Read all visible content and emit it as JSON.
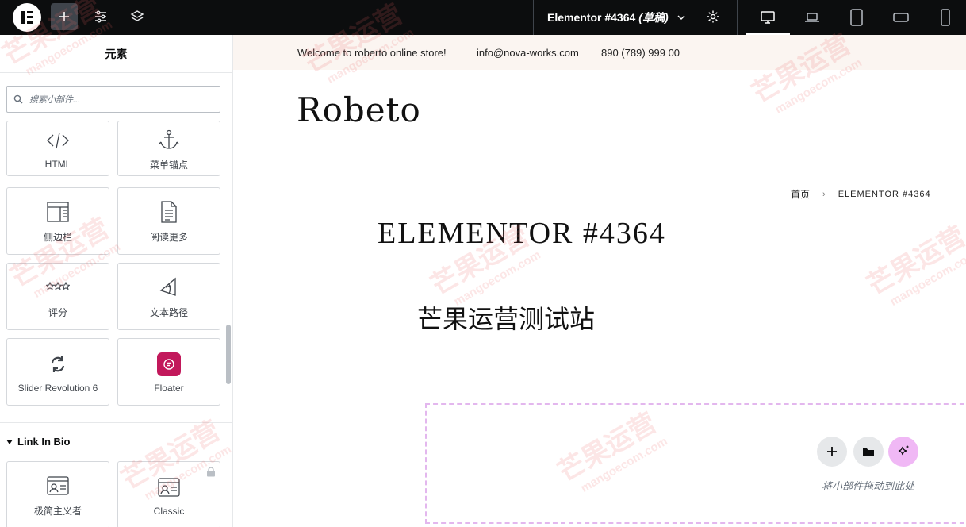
{
  "topbar": {
    "logo_icon": "elementor-logo-icon",
    "add_icon": "plus-icon",
    "settings_icon": "sliders-icon",
    "structure_icon": "layers-icon",
    "doc_title": "Elementor #4364",
    "doc_status": "(草稿)",
    "page_settings_icon": "gear-icon",
    "devices": [
      "desktop",
      "laptop",
      "tablet",
      "mobile-landscape",
      "mobile"
    ]
  },
  "panel": {
    "title": "元素",
    "search_placeholder": "搜索小部件...",
    "widgets": [
      {
        "label": "HTML",
        "icon": "code-icon"
      },
      {
        "label": "菜单锚点",
        "icon": "anchor-icon"
      },
      {
        "label": "侧边栏",
        "icon": "sidebar-icon"
      },
      {
        "label": "阅读更多",
        "icon": "read-more-icon"
      },
      {
        "label": "评分",
        "icon": "stars-icon"
      },
      {
        "label": "文本路径",
        "icon": "text-path-icon"
      },
      {
        "label": "Slider Revolution 6",
        "icon": "revolution-icon"
      },
      {
        "label": "Floater",
        "icon": "floater-icon"
      }
    ],
    "section_title": "Link In Bio",
    "section_widgets": [
      {
        "label": "极简主义者",
        "icon": "bio-card-icon"
      },
      {
        "label": "Classic",
        "icon": "bio-card-icon",
        "locked": true
      }
    ]
  },
  "preview": {
    "announce_welcome": "Welcome to roberto online store!",
    "announce_email": "info@nova-works.com",
    "announce_phone": "890 (789) 999 00",
    "brand": "Robeto",
    "breadcrumb_home": "首页",
    "breadcrumb_current": "ELEMENTOR #4364",
    "page_title": "ELEMENTOR #4364",
    "page_subtitle": "芒果运营测试站",
    "dropzone_text": "将小部件拖动到此处",
    "dropzone_buttons": [
      "add-section",
      "template-library",
      "ai-generate"
    ]
  },
  "watermark": {
    "text": "芒果运营",
    "url": "mangoecom.com"
  },
  "colors": {
    "topbar_bg": "#0c0d0e",
    "floater_badge": "#c2185b",
    "ai_button": "#f0b8f5",
    "dropzone_border": "#e3b7ee",
    "announce_bg": "#fbf5f1"
  }
}
